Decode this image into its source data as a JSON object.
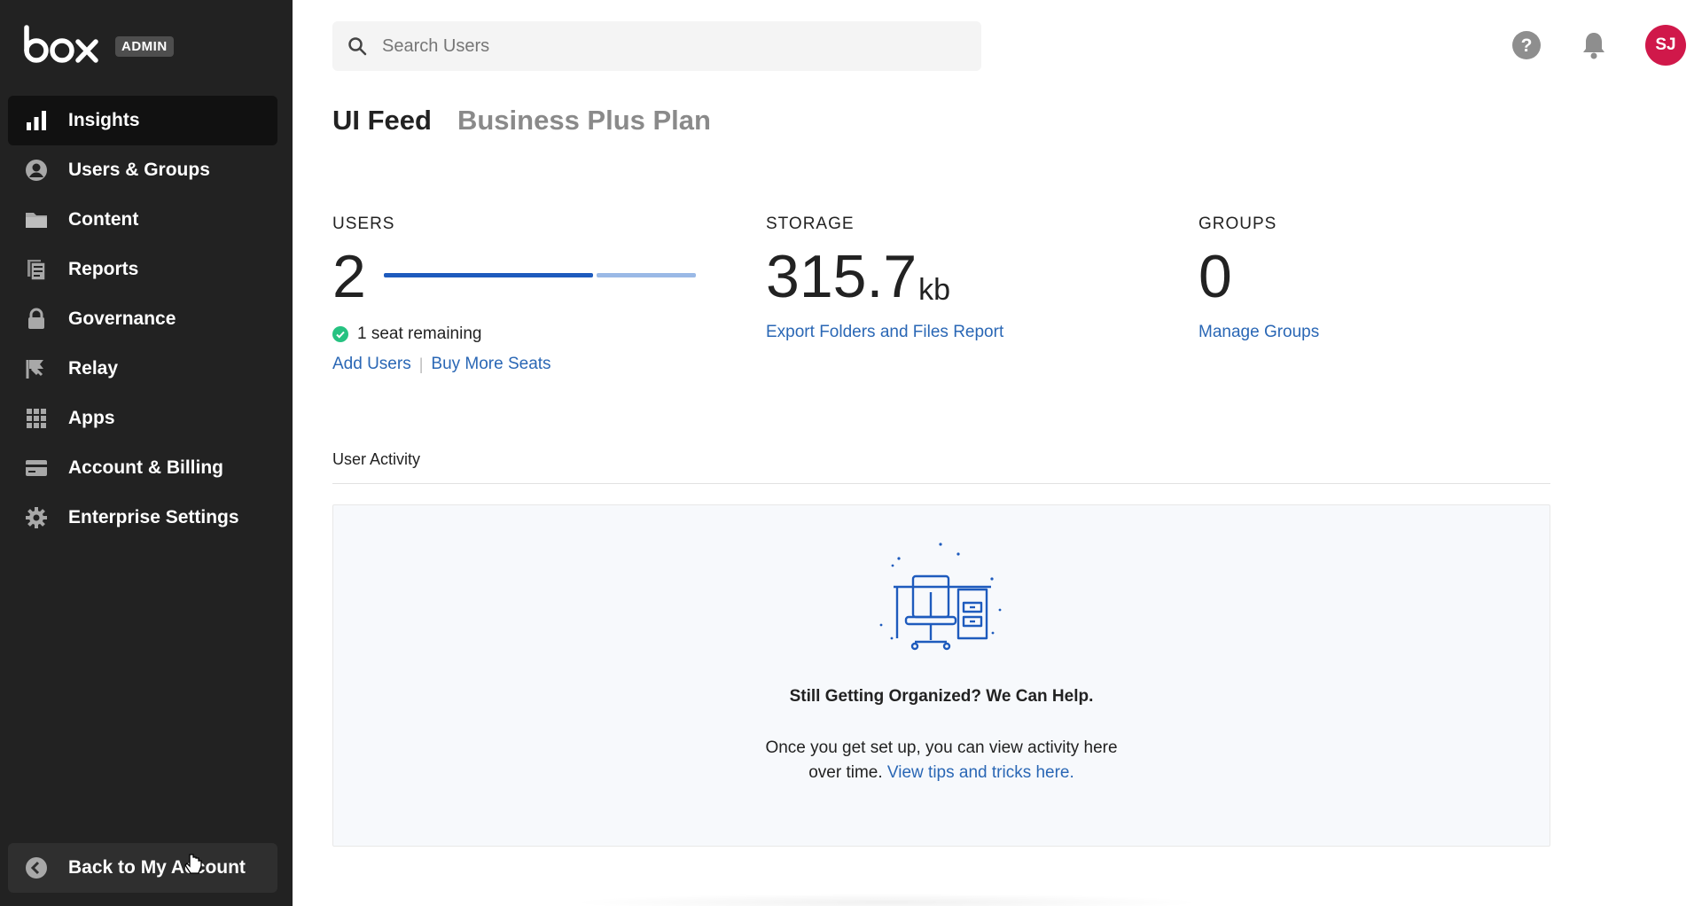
{
  "brand": {
    "logo_text": "box",
    "badge": "ADMIN"
  },
  "sidebar": {
    "items": [
      {
        "label": "Insights",
        "icon": "bar-chart-icon",
        "active": true
      },
      {
        "label": "Users & Groups",
        "icon": "user-circle-icon",
        "active": false
      },
      {
        "label": "Content",
        "icon": "folder-icon",
        "active": false
      },
      {
        "label": "Reports",
        "icon": "report-icon",
        "active": false
      },
      {
        "label": "Governance",
        "icon": "lock-icon",
        "active": false
      },
      {
        "label": "Relay",
        "icon": "relay-flag-icon",
        "active": false
      },
      {
        "label": "Apps",
        "icon": "grid-icon",
        "active": false
      },
      {
        "label": "Account & Billing",
        "icon": "credit-card-icon",
        "active": false
      },
      {
        "label": "Enterprise Settings",
        "icon": "gear-icon",
        "active": false
      }
    ],
    "back_label": "Back to My Account"
  },
  "search": {
    "placeholder": "Search Users",
    "value": ""
  },
  "user": {
    "initials": "SJ",
    "avatar_color": "#d0184a"
  },
  "header": {
    "title": "UI Feed",
    "plan": "Business Plus Plan"
  },
  "stats": {
    "users": {
      "label": "USERS",
      "value": "2",
      "seats_used_fraction": 0.67,
      "seats_remaining": "1 seat remaining",
      "add_users": "Add Users",
      "buy_seats": "Buy More Seats"
    },
    "storage": {
      "label": "STORAGE",
      "value": "315.7",
      "unit": "kb",
      "link": "Export Folders and Files Report"
    },
    "groups": {
      "label": "GROUPS",
      "value": "0",
      "link": "Manage Groups"
    }
  },
  "activity": {
    "title": "User Activity",
    "empty_title": "Still Getting Organized? We Can Help.",
    "empty_text_1": "Once you get set up, you can view activity here",
    "empty_text_2": "over time.",
    "empty_link": "View tips and tricks here."
  },
  "colors": {
    "sidebar_bg": "#222222",
    "link": "#2a67b5",
    "bar_used": "#1e5bbd",
    "bar_free": "#9ab9e6",
    "success": "#26c281"
  }
}
